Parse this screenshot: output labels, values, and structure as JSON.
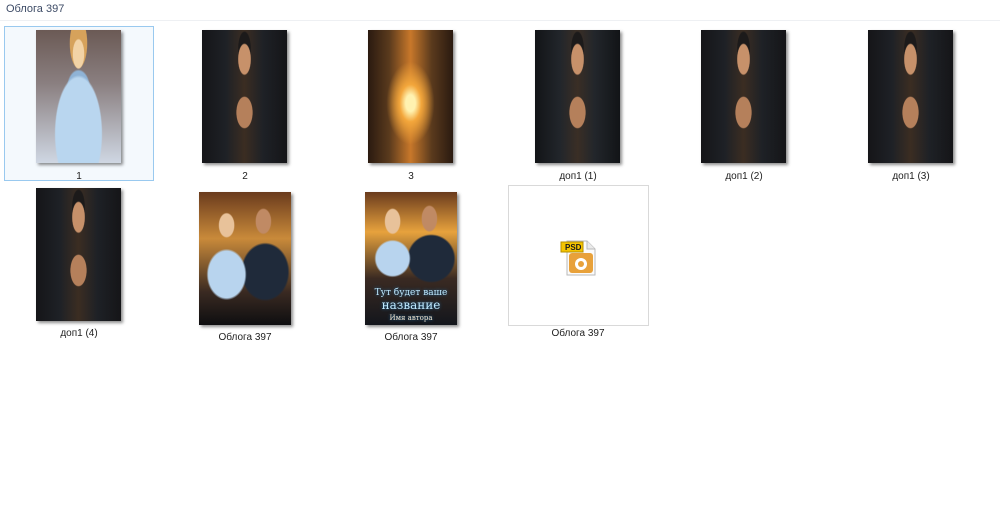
{
  "window": {
    "title": "Облога 397"
  },
  "files": [
    {
      "label": "1",
      "kind": "image",
      "selected": true
    },
    {
      "label": "2",
      "kind": "image"
    },
    {
      "label": "3",
      "kind": "image"
    },
    {
      "label": "доп1 (1)",
      "kind": "image"
    },
    {
      "label": "доп1 (2)",
      "kind": "image"
    },
    {
      "label": "доп1 (3)",
      "kind": "image"
    },
    {
      "label": "доп1 (4)",
      "kind": "image"
    },
    {
      "label": "Облога  397",
      "kind": "image"
    },
    {
      "label": "Облога 397",
      "kind": "image",
      "cover_text_line1": "Тут будет ваше",
      "cover_text_line2": "название",
      "cover_text_line3": "Имя автора"
    },
    {
      "label": "Облога 397",
      "kind": "psd",
      "badge": "PSD"
    }
  ],
  "colors": {
    "selection_border": "#99c9ef",
    "psd_badge": "#f5c400",
    "psd_icon": "#e8a13a"
  },
  "icons": {
    "psd_file": "psd-file-icon"
  }
}
